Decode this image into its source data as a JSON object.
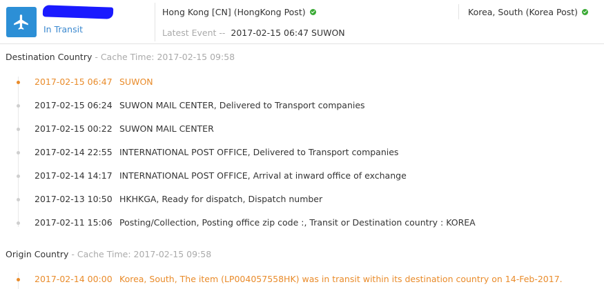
{
  "header": {
    "status": "In Transit",
    "origin_carrier": "Hong Kong [CN] (HongKong Post)",
    "destination_carrier": "Korea, South (Korea Post)",
    "latest_event_label": "Latest Event --",
    "latest_event_value": "2017-02-15 06:47 SUWON"
  },
  "destination": {
    "title": "Destination Country",
    "cache": " - Cache Time: 2017-02-15 09:58",
    "events": [
      {
        "time": "2017-02-15 06:47",
        "desc": "SUWON"
      },
      {
        "time": "2017-02-15 06:24",
        "desc": "SUWON MAIL CENTER, Delivered to Transport companies"
      },
      {
        "time": "2017-02-15 00:22",
        "desc": "SUWON MAIL CENTER"
      },
      {
        "time": "2017-02-14 22:55",
        "desc": "INTERNATIONAL POST OFFICE, Delivered to Transport companies"
      },
      {
        "time": "2017-02-14 14:17",
        "desc": "INTERNATIONAL POST OFFICE, Arrival at inward office of exchange"
      },
      {
        "time": "2017-02-13 10:50",
        "desc": "HKHKGA, Ready for dispatch, Dispatch number"
      },
      {
        "time": "2017-02-11 15:06",
        "desc": "Posting/Collection, Posting office zip code :, Transit or Destination country : KOREA"
      }
    ]
  },
  "origin": {
    "title": "Origin Country",
    "cache": " - Cache Time: 2017-02-15 09:58",
    "events": [
      {
        "time": "2017-02-14 00:00",
        "desc": "Korea, South, The item (LP004057558HK) was in transit within its destination country on 14-Feb-2017."
      }
    ]
  },
  "colors": {
    "accent_blue": "#2c8fd6",
    "active_orange": "#e98b2a",
    "check_green": "#3aaa35"
  },
  "icons": [
    "airplane-icon",
    "check-circle-icon"
  ]
}
